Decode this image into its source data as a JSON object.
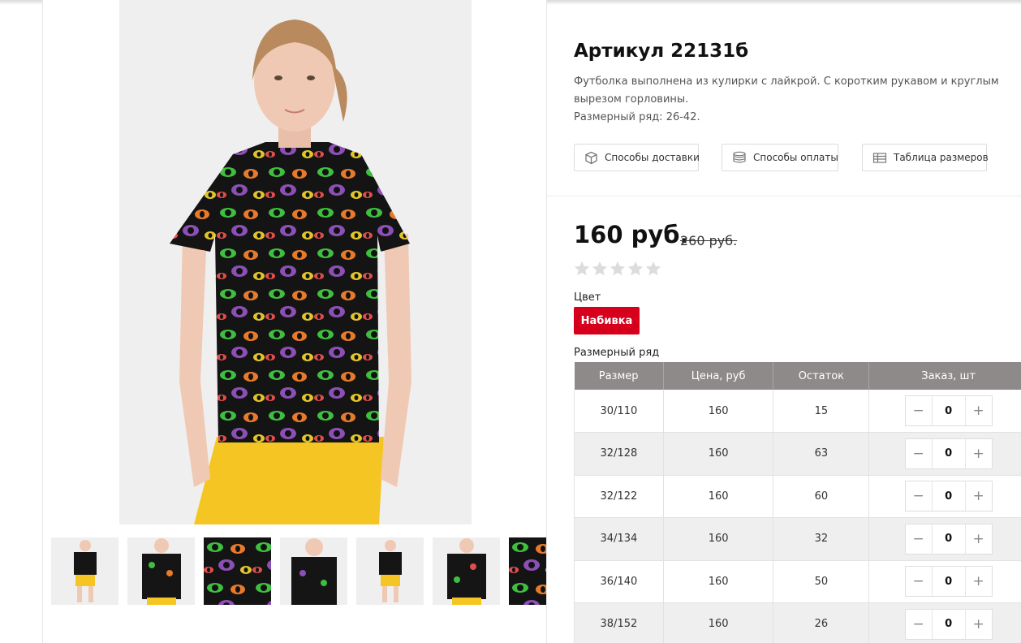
{
  "product": {
    "title": "Артикул 22131б",
    "description": [
      "Футболка выполнена из кулирки с лайкрой. С коротким рукавом и круглым",
      "вырезом горловины.",
      "Размерный ряд: 26-42."
    ]
  },
  "info_buttons": [
    {
      "label": "Способы доставки",
      "icon": "box-icon"
    },
    {
      "label": "Способы оплаты",
      "icon": "coins-icon"
    },
    {
      "label": "Таблица размеров",
      "icon": "table-icon"
    }
  ],
  "price": {
    "current": "160 руб.",
    "old": "260 руб."
  },
  "rating": {
    "stars_filled": 0,
    "stars_total": 5
  },
  "color": {
    "label": "Цвет",
    "selected": "Набивка",
    "accent": "#d6001c"
  },
  "size_table": {
    "label": "Размерный ряд",
    "headers": [
      "Размер",
      "Цена, руб",
      "Остаток",
      "Заказ, шт"
    ],
    "rows": [
      {
        "size": "30/110",
        "price": "160",
        "stock": "15",
        "qty": "0"
      },
      {
        "size": "32/128",
        "price": "160",
        "stock": "63",
        "qty": "0"
      },
      {
        "size": "32/122",
        "price": "160",
        "stock": "60",
        "qty": "0"
      },
      {
        "size": "34/134",
        "price": "160",
        "stock": "32",
        "qty": "0"
      },
      {
        "size": "36/140",
        "price": "160",
        "stock": "50",
        "qty": "0"
      },
      {
        "size": "38/152",
        "price": "160",
        "stock": "26",
        "qty": "0"
      }
    ],
    "minus_symbol": "−",
    "plus_symbol": "+"
  },
  "gallery": {
    "thumbnail_count": 7,
    "colors": {
      "shirt": "#151515",
      "shorts": "#f5c623",
      "skin": "#f0c9b4",
      "hair": "#b98a5e",
      "background": "#efefef"
    }
  }
}
